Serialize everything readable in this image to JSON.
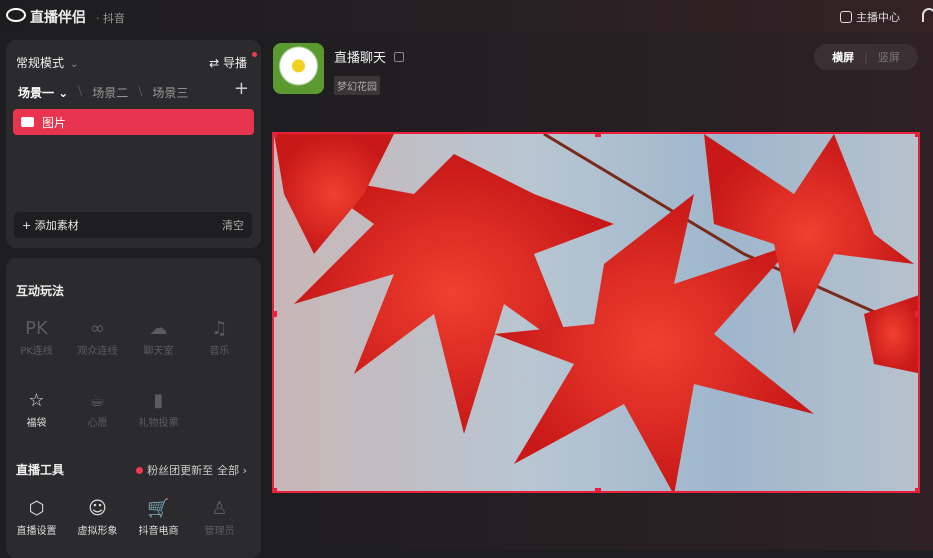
{
  "app": {
    "title": "直播伴侣",
    "platform": "· 抖音",
    "anchor_center": "主播中心"
  },
  "scene_panel": {
    "mode": "常规模式",
    "guide": "导播",
    "scenes": [
      "场景一",
      "场景二",
      "场景三"
    ],
    "source_item": "图片",
    "add_source": "添加素材",
    "clear": "清空"
  },
  "interactive": {
    "title": "互动玩法",
    "items": [
      {
        "icon": "PK",
        "label": "PK连线"
      },
      {
        "icon": "∞",
        "label": "观众连线"
      },
      {
        "icon": "☁",
        "label": "聊天室"
      },
      {
        "icon": "♫",
        "label": "音乐"
      },
      {
        "icon": "☆",
        "label": "福袋"
      },
      {
        "icon": "☕",
        "label": "心愿"
      },
      {
        "icon": "▮",
        "label": "礼物投票"
      }
    ]
  },
  "tools": {
    "title": "直播工具",
    "notice": "粉丝团更新至",
    "all": "全部 ›",
    "items": [
      {
        "icon": "⬡",
        "label": "直播设置"
      },
      {
        "icon": "☺",
        "label": "虚拟形象"
      },
      {
        "icon": "🛒",
        "label": "抖音电商"
      },
      {
        "icon": "♙",
        "label": "管理员"
      }
    ]
  },
  "room": {
    "title": "直播聊天",
    "tag": "梦幻花园",
    "landscape": "横屏",
    "portrait": "竖屏"
  },
  "colors": {
    "accent": "#e8344f",
    "selection": "#e8203a"
  }
}
